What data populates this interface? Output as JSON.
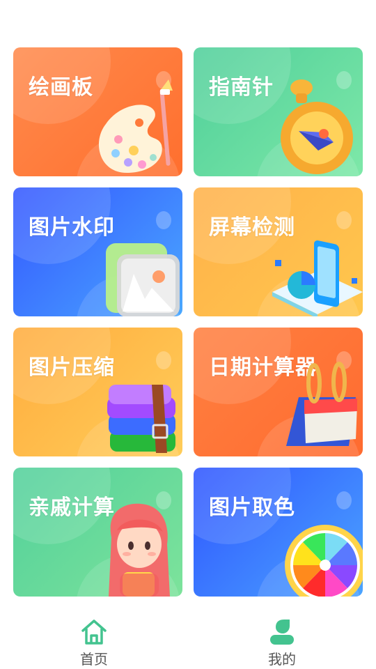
{
  "cards": [
    {
      "title": "绘画板"
    },
    {
      "title": "指南针"
    },
    {
      "title": "图片水印"
    },
    {
      "title": "屏幕检测"
    },
    {
      "title": "图片压缩"
    },
    {
      "title": "日期计算器"
    },
    {
      "title": "亲戚计算"
    },
    {
      "title": "图片取色"
    }
  ],
  "tabbar": {
    "home_label": "首页",
    "mine_label": "我的",
    "accent": "#43c38f"
  }
}
